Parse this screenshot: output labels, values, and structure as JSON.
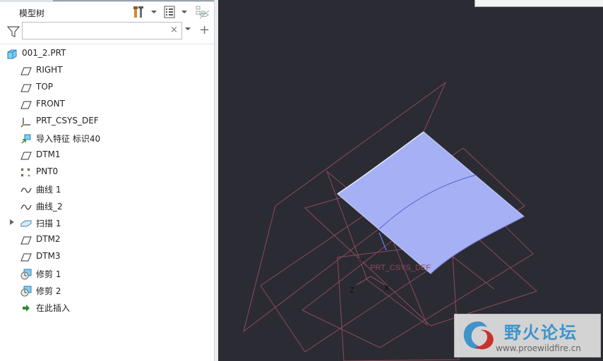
{
  "panel": {
    "title": "模型树",
    "search": {
      "value": "",
      "placeholder": "",
      "clear_glyph": "×",
      "add_glyph": "+"
    },
    "header_icons": [
      "settings-tools-icon",
      "tree-columns-icon",
      "show-hide-icon"
    ]
  },
  "tree": {
    "items": [
      {
        "label": "001_2.PRT",
        "icon": "part-icon"
      },
      {
        "label": "RIGHT",
        "icon": "datum-plane-icon"
      },
      {
        "label": "TOP",
        "icon": "datum-plane-icon"
      },
      {
        "label": "FRONT",
        "icon": "datum-plane-icon"
      },
      {
        "label": "PRT_CSYS_DEF",
        "icon": "csys-icon"
      },
      {
        "label": "导入特征 标识40",
        "icon": "import-feature-icon"
      },
      {
        "label": "DTM1",
        "icon": "datum-plane-icon"
      },
      {
        "label": "PNT0",
        "icon": "datum-point-icon"
      },
      {
        "label": "曲线 1",
        "icon": "curve-icon"
      },
      {
        "label": "曲线_2",
        "icon": "curve-icon"
      },
      {
        "label": "扫描 1",
        "icon": "sweep-icon"
      },
      {
        "label": "DTM2",
        "icon": "datum-plane-icon"
      },
      {
        "label": "DTM3",
        "icon": "datum-plane-icon"
      },
      {
        "label": "修剪 1",
        "icon": "trim-icon"
      },
      {
        "label": "修剪 2",
        "icon": "trim-icon"
      },
      {
        "label": "在此插入",
        "icon": "insert-here-arrow-icon"
      }
    ]
  },
  "viewport": {
    "csys_label": "PRT_CSYS_DEF",
    "axis_x": "X",
    "axis_y": "Y",
    "axis_z": "Z"
  },
  "watermark": {
    "title": "野火论坛",
    "url": "www.proewildfire.cn"
  },
  "colors": {
    "viewport_bg": "#2b2b33",
    "datum_plane": "#8c4a5a",
    "surface": "#a6b0f4",
    "accent": "#3f93c9"
  }
}
